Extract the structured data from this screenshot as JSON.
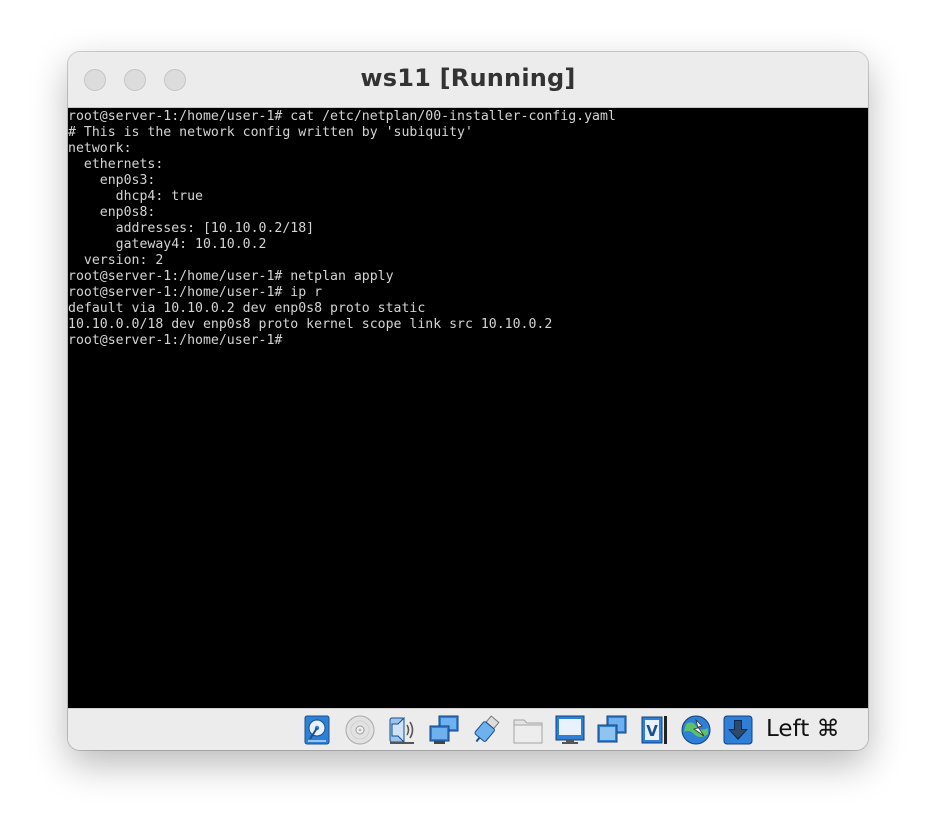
{
  "window": {
    "title": "ws11 [Running]"
  },
  "terminal": {
    "lines": [
      "root@server-1:/home/user-1# cat /etc/netplan/00-installer-config.yaml",
      "# This is the network config written by 'subiquity'",
      "network:",
      "  ethernets:",
      "    enp0s3:",
      "      dhcp4: true",
      "    enp0s8:",
      "      addresses: [10.10.0.2/18]",
      "      gateway4: 10.10.0.2",
      "  version: 2",
      "root@server-1:/home/user-1# netplan apply",
      "root@server-1:/home/user-1# ip r",
      "default via 10.10.0.2 dev enp0s8 proto static",
      "10.10.0.0/18 dev enp0s8 proto kernel scope link src 10.10.0.2",
      "root@server-1:/home/user-1#"
    ]
  },
  "statusbar": {
    "icons": [
      "hard-disk-icon",
      "optical-drive-icon",
      "audio-icon",
      "network-icon",
      "usb-icon",
      "shared-folders-icon",
      "display-icon",
      "video-capture-icon",
      "virtualization-icon",
      "guest-additions-icon",
      "mouse-integration-icon"
    ],
    "host_key": "Left ⌘"
  },
  "colors": {
    "titlebar": "#ececec",
    "terminal_bg": "#000000",
    "terminal_fg": "#d4d4d4",
    "accent_blue": "#1f6fc9"
  }
}
